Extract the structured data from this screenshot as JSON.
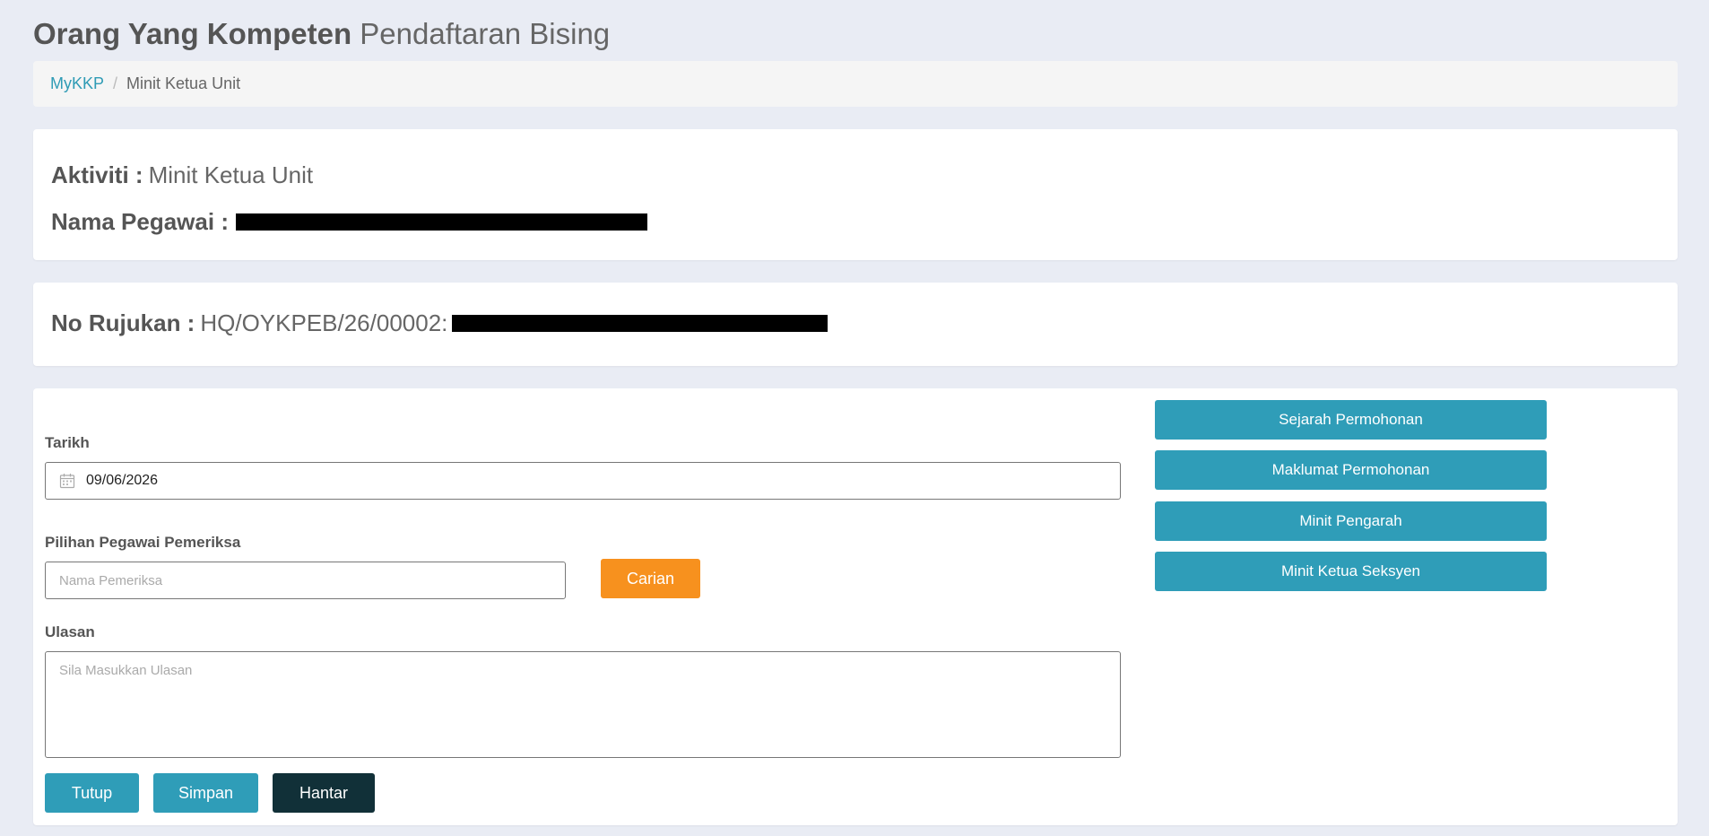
{
  "header": {
    "title_strong": "Orang Yang Kompeten",
    "title_light": "Pendaftaran Bising"
  },
  "breadcrumb": {
    "home": "MyKKP",
    "separator": "/",
    "current": "Minit Ketua Unit"
  },
  "activity_card": {
    "activity_label": "Aktiviti :",
    "activity_value": "Minit Ketua Unit",
    "officer_label": "Nama Pegawai :"
  },
  "reference_card": {
    "label": "No Rujukan :",
    "value": "HQ/OYKPEB/26/00002:"
  },
  "form": {
    "date_label": "Tarikh",
    "date_value": "09/06/2026",
    "inspector_label": "Pilihan Pegawai Pemeriksa",
    "inspector_placeholder": "Nama Pemeriksa",
    "search_button": "Carian",
    "review_label": "Ulasan",
    "review_placeholder": "Sila Masukkan Ulasan",
    "close_button": "Tutup",
    "save_button": "Simpan",
    "send_button": "Hantar"
  },
  "side_buttons": {
    "history": "Sejarah Permohonan",
    "applicant_info": "Maklumat Permohonan",
    "director_minutes": "Minit Pengarah",
    "section_head_minutes": "Minit Ketua Seksyen"
  },
  "colors": {
    "accent_teal": "#2f9db8",
    "search_orange": "#f7911e",
    "send_dark": "#113038",
    "page_background": "#e9ecf4"
  },
  "icons": {
    "date_field": "calendar-icon"
  }
}
